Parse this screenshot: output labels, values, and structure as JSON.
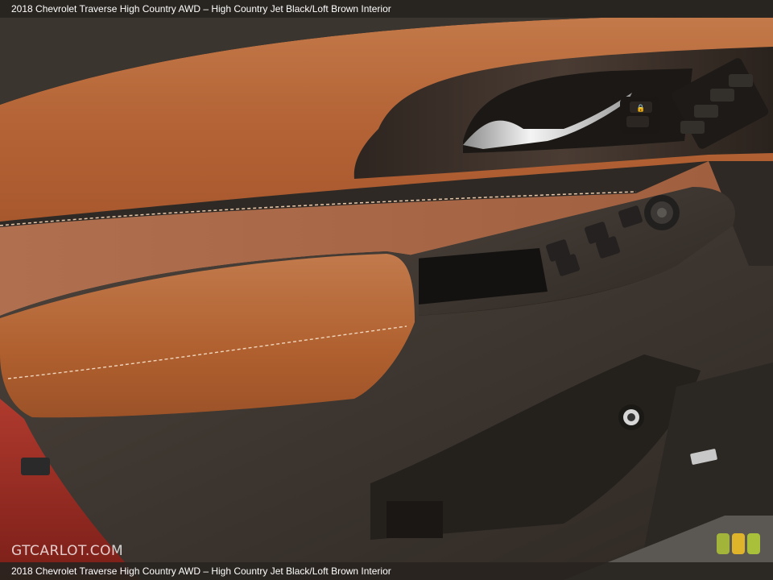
{
  "caption": {
    "top": "2018 Chevrolet Traverse High Country AWD – High Country Jet Black/Loft Brown Interior",
    "bottom": "2018 Chevrolet Traverse High Country AWD – High Country Jet Black/Loft Brown Interior"
  },
  "watermark": "GTCARLOT.COM",
  "colors": {
    "leather": "#b96a3c",
    "suede": "#a86a48",
    "plastic": "#3a332d",
    "wood": "#3b302a",
    "exterior": "#9b2a22",
    "chrome": "#d9d9d9",
    "badge": [
      "#a3b43a",
      "#e0b42a",
      "#a8c03a"
    ]
  },
  "icons": {
    "door_handle": "door-handle-icon",
    "lock_switch": "lock-switch-icon",
    "memory_buttons": "memory-seat-icon",
    "window_switches": "window-switch-icon",
    "mirror_control": "mirror-control-icon",
    "door_lock_knob": "door-lock-knob-icon",
    "speaker_badge": "speaker-badge-icon"
  }
}
